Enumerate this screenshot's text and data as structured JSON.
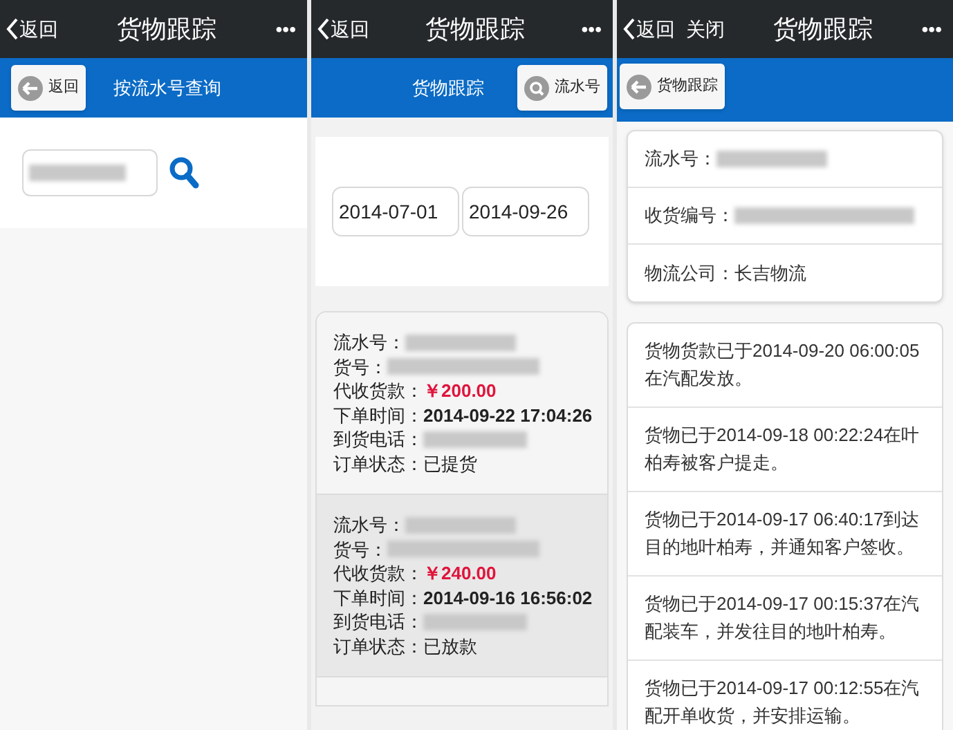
{
  "panels": [
    {
      "kind": "search",
      "header": {
        "back": "返回",
        "title": "货物跟踪",
        "more": "•••"
      },
      "toolbar": {
        "button": {
          "label": "返回",
          "kind": "back"
        },
        "title": "按流水号查询"
      }
    },
    {
      "kind": "list",
      "header": {
        "back": "返回",
        "title": "货物跟踪",
        "more": "•••"
      },
      "toolbar": {
        "title": "货物跟踪",
        "button": {
          "label": "流水号",
          "kind": "search"
        }
      },
      "dates": [
        "2014-07-01",
        "2014-09-26"
      ],
      "orders": [
        {
          "selected": false,
          "fields": [
            {
              "kind": "redacted",
              "label": "流水号："
            },
            {
              "kind": "redacted",
              "label": "货号："
            },
            {
              "kind": "amount",
              "label": "代收货款：",
              "value": "￥200.00"
            },
            {
              "kind": "bold",
              "label": "下单时间：",
              "value": "2014-09-22 17:04:26"
            },
            {
              "kind": "redacted",
              "label": "到货电话："
            },
            {
              "kind": "plain",
              "label": "订单状态：",
              "value": "已提货"
            }
          ]
        },
        {
          "selected": true,
          "fields": [
            {
              "kind": "redacted",
              "label": "流水号："
            },
            {
              "kind": "redacted",
              "label": "货号："
            },
            {
              "kind": "amount",
              "label": "代收货款：",
              "value": "￥240.00"
            },
            {
              "kind": "bold",
              "label": "下单时间：",
              "value": "2014-09-16 16:56:02"
            },
            {
              "kind": "redacted",
              "label": "到货电话："
            },
            {
              "kind": "plain",
              "label": "订单状态：",
              "value": "已放款"
            }
          ]
        }
      ]
    },
    {
      "kind": "detail",
      "header": {
        "back": "返回",
        "close": "关闭",
        "title": "货物跟踪",
        "more": "•••"
      },
      "toolbar": {
        "button": {
          "label": "货物跟踪",
          "kind": "back"
        }
      },
      "info": [
        {
          "kind": "redacted",
          "label": "流水号："
        },
        {
          "kind": "redacted",
          "label": "收货编号："
        },
        {
          "kind": "plain",
          "label": "物流公司：",
          "value": "长吉物流"
        }
      ],
      "events": [
        "货物货款已于2014-09-20 06:00:05在汽配发放。",
        "货物已于2014-09-18 00:22:24在叶柏寿被客户提走。",
        "货物已于2014-09-17 06:40:17到达目的地叶柏寿，并通知客户签收。",
        "货物已于2014-09-17 00:15:37在汽配装车，并发往目的地叶柏寿。",
        "货物已于2014-09-17 00:12:55在汽配开单收货，并安排运输。"
      ]
    }
  ]
}
